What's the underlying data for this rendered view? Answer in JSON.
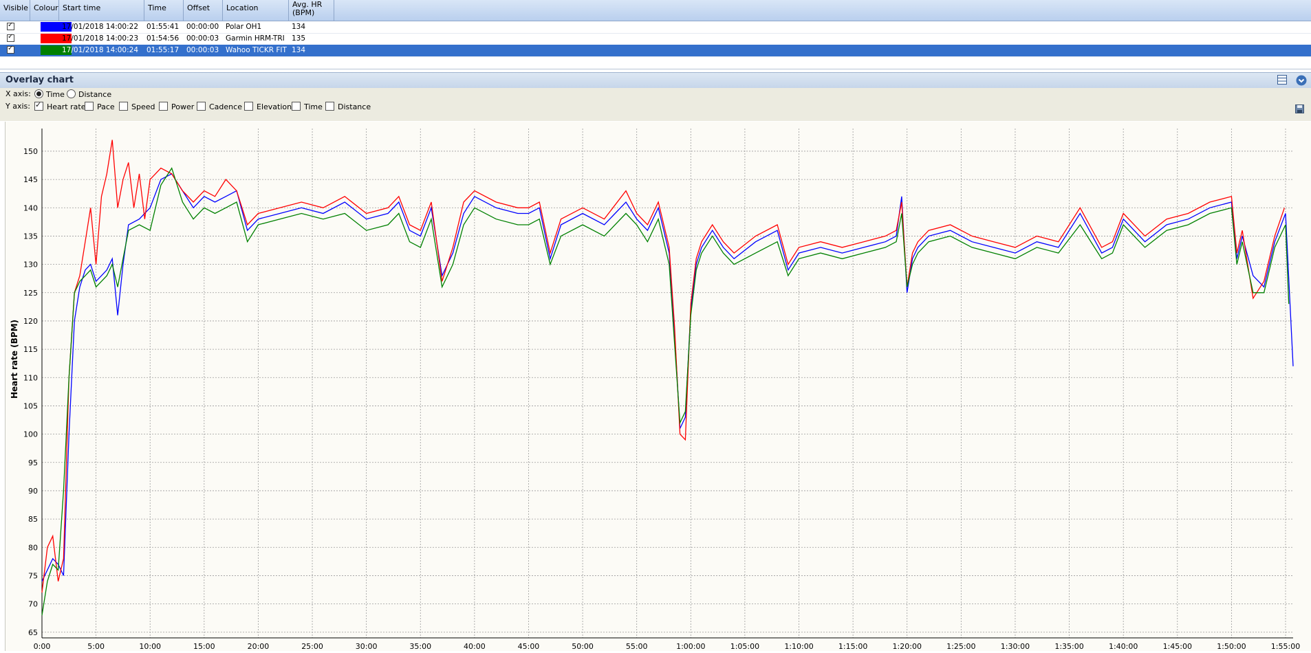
{
  "grid": {
    "headers": [
      "Visible",
      "Colour",
      "Start time",
      "Time",
      "Offset",
      "Location",
      "Avg. HR (BPM)"
    ],
    "rows": [
      {
        "start": "17/01/2018 14:00:22",
        "time": "01:55:41",
        "offset": "00:00:00",
        "location": "Polar OH1",
        "avg_hr": "134",
        "color": "#0000ff",
        "visible": true
      },
      {
        "start": "17/01/2018 14:00:23",
        "time": "01:54:56",
        "offset": "00:00:03",
        "location": "Garmin HRM-TRI",
        "avg_hr": "135",
        "color": "#ff0000",
        "visible": true
      },
      {
        "start": "17/01/2018 14:00:24",
        "time": "01:55:17",
        "offset": "00:00:03",
        "location": "Wahoo TICKR FIT",
        "avg_hr": "134",
        "color": "#008000",
        "visible": true,
        "selected": true
      }
    ]
  },
  "panel": {
    "title": "Overlay chart",
    "x_axis_label": "X axis:",
    "x_options": [
      {
        "label": "Time",
        "selected": true
      },
      {
        "label": "Distance",
        "selected": false
      }
    ],
    "y_axis_label": "Y axis:",
    "y_options": [
      {
        "label": "Heart rate",
        "checked": true
      },
      {
        "label": "Pace",
        "checked": false
      },
      {
        "label": "Speed",
        "checked": false
      },
      {
        "label": "Power",
        "checked": false
      },
      {
        "label": "Cadence",
        "checked": false
      },
      {
        "label": "Elevation",
        "checked": false
      },
      {
        "label": "Time",
        "checked": false
      },
      {
        "label": "Distance",
        "checked": false
      }
    ]
  },
  "chart_data": {
    "type": "line",
    "xlabel": "Time",
    "ylabel": "Heart rate (BPM)",
    "xlim": [
      0,
      115.7
    ],
    "ylim": [
      64,
      154
    ],
    "x_ticks": [
      {
        "v": 0,
        "label": "0:00"
      },
      {
        "v": 5,
        "label": "5:00"
      },
      {
        "v": 10,
        "label": "10:00"
      },
      {
        "v": 15,
        "label": "15:00"
      },
      {
        "v": 20,
        "label": "20:00"
      },
      {
        "v": 25,
        "label": "25:00"
      },
      {
        "v": 30,
        "label": "30:00"
      },
      {
        "v": 35,
        "label": "35:00"
      },
      {
        "v": 40,
        "label": "40:00"
      },
      {
        "v": 45,
        "label": "45:00"
      },
      {
        "v": 50,
        "label": "50:00"
      },
      {
        "v": 55,
        "label": "55:00"
      },
      {
        "v": 60,
        "label": "1:00:00"
      },
      {
        "v": 65,
        "label": "1:05:00"
      },
      {
        "v": 70,
        "label": "1:10:00"
      },
      {
        "v": 75,
        "label": "1:15:00"
      },
      {
        "v": 80,
        "label": "1:20:00"
      },
      {
        "v": 85,
        "label": "1:25:00"
      },
      {
        "v": 90,
        "label": "1:30:00"
      },
      {
        "v": 95,
        "label": "1:35:00"
      },
      {
        "v": 100,
        "label": "1:40:00"
      },
      {
        "v": 105,
        "label": "1:45:00"
      },
      {
        "v": 110,
        "label": "1:50:00"
      },
      {
        "v": 115,
        "label": "1:55:00"
      }
    ],
    "y_ticks": [
      65,
      70,
      75,
      80,
      85,
      90,
      95,
      100,
      105,
      110,
      115,
      120,
      125,
      130,
      135,
      140,
      145,
      150
    ],
    "grid": true,
    "series": [
      {
        "name": "Polar OH1",
        "color": "#0000ff",
        "x": [
          0,
          0.5,
          1,
          1.5,
          2,
          2.5,
          3,
          3.5,
          4,
          4.5,
          5,
          5.5,
          6,
          6.5,
          7,
          7.5,
          8,
          9,
          10,
          11,
          12,
          13,
          14,
          15,
          16,
          17,
          18,
          19,
          20,
          22,
          24,
          26,
          28,
          30,
          32,
          33,
          34,
          35,
          36,
          37,
          38,
          39,
          40,
          42,
          44,
          45,
          46,
          47,
          48,
          50,
          52,
          54,
          55,
          56,
          57,
          58,
          58.5,
          59,
          59.5,
          60,
          60.5,
          61,
          62,
          63,
          64,
          66,
          68,
          69,
          70,
          72,
          74,
          76,
          78,
          79,
          79.5,
          80,
          80.5,
          81,
          82,
          84,
          86,
          88,
          90,
          92,
          94,
          96,
          98,
          99,
          100,
          102,
          104,
          106,
          108,
          110,
          110.5,
          111,
          112,
          113,
          114,
          115,
          115.7
        ],
        "y": [
          74,
          76,
          78,
          77,
          75,
          100,
          120,
          126,
          129,
          130,
          127,
          128,
          129,
          131,
          121,
          130,
          137,
          138,
          140,
          145,
          146,
          143,
          140,
          142,
          141,
          142,
          143,
          136,
          138,
          139,
          140,
          139,
          141,
          138,
          139,
          141,
          136,
          135,
          140,
          128,
          132,
          139,
          142,
          140,
          139,
          139,
          140,
          131,
          137,
          139,
          137,
          141,
          138,
          136,
          140,
          132,
          118,
          101,
          103,
          122,
          130,
          133,
          136,
          133,
          131,
          134,
          136,
          129,
          132,
          133,
          132,
          133,
          134,
          135,
          142,
          125,
          131,
          133,
          135,
          136,
          134,
          133,
          132,
          134,
          133,
          139,
          132,
          133,
          138,
          134,
          137,
          138,
          140,
          141,
          131,
          135,
          128,
          126,
          134,
          139,
          112
        ]
      },
      {
        "name": "Garmin HRM-TRI",
        "color": "#ff0000",
        "x": [
          0,
          0.5,
          1,
          1.5,
          2,
          2.5,
          3,
          3.5,
          4,
          4.5,
          5,
          5.5,
          6,
          6.5,
          7,
          7.5,
          8,
          8.5,
          9,
          9.5,
          10,
          11,
          12,
          13,
          14,
          15,
          16,
          17,
          18,
          19,
          20,
          22,
          24,
          26,
          28,
          30,
          32,
          33,
          34,
          35,
          36,
          37,
          38,
          39,
          40,
          42,
          44,
          45,
          46,
          47,
          48,
          50,
          52,
          54,
          55,
          56,
          57,
          58,
          58.5,
          59,
          59.5,
          60,
          60.5,
          61,
          62,
          63,
          64,
          66,
          68,
          69,
          70,
          72,
          74,
          76,
          78,
          79,
          79.5,
          80,
          80.5,
          81,
          82,
          84,
          86,
          88,
          90,
          92,
          94,
          96,
          98,
          99,
          100,
          102,
          104,
          106,
          108,
          110,
          110.5,
          111,
          112,
          113,
          114,
          114.9
        ],
        "y": [
          72,
          80,
          82,
          74,
          78,
          110,
          125,
          128,
          134,
          140,
          130,
          142,
          146,
          152,
          140,
          145,
          148,
          140,
          146,
          138,
          145,
          147,
          146,
          143,
          141,
          143,
          142,
          145,
          143,
          137,
          139,
          140,
          141,
          140,
          142,
          139,
          140,
          142,
          137,
          136,
          141,
          127,
          133,
          141,
          143,
          141,
          140,
          140,
          141,
          132,
          138,
          140,
          138,
          143,
          139,
          137,
          141,
          133,
          119,
          100,
          99,
          123,
          131,
          134,
          137,
          134,
          132,
          135,
          137,
          130,
          133,
          134,
          133,
          134,
          135,
          136,
          141,
          126,
          132,
          134,
          136,
          137,
          135,
          134,
          133,
          135,
          134,
          140,
          133,
          134,
          139,
          135,
          138,
          139,
          141,
          142,
          132,
          136,
          124,
          127,
          135,
          140
        ]
      },
      {
        "name": "Wahoo TICKR FIT",
        "color": "#008000",
        "x": [
          0,
          0.5,
          1,
          1.5,
          2,
          2.5,
          3,
          3.5,
          4,
          4.5,
          5,
          5.5,
          6,
          6.5,
          7,
          7.5,
          8,
          9,
          10,
          11,
          12,
          13,
          14,
          15,
          16,
          17,
          18,
          19,
          20,
          22,
          24,
          26,
          28,
          30,
          32,
          33,
          34,
          35,
          36,
          37,
          38,
          39,
          40,
          42,
          44,
          45,
          46,
          47,
          48,
          50,
          52,
          54,
          55,
          56,
          57,
          58,
          58.5,
          59,
          59.5,
          60,
          60.5,
          61,
          62,
          63,
          64,
          66,
          68,
          69,
          70,
          72,
          74,
          76,
          78,
          79,
          79.5,
          80,
          80.5,
          81,
          82,
          84,
          86,
          88,
          90,
          92,
          94,
          96,
          98,
          99,
          100,
          102,
          104,
          106,
          108,
          110,
          110.5,
          111,
          112,
          113,
          114,
          115,
          115.3
        ],
        "y": [
          68,
          74,
          77,
          76,
          90,
          110,
          125,
          127,
          128,
          129,
          126,
          127,
          128,
          130,
          126,
          131,
          136,
          137,
          136,
          144,
          147,
          141,
          138,
          140,
          139,
          140,
          141,
          134,
          137,
          138,
          139,
          138,
          139,
          136,
          137,
          139,
          134,
          133,
          138,
          126,
          130,
          137,
          140,
          138,
          137,
          137,
          138,
          130,
          135,
          137,
          135,
          139,
          137,
          134,
          138,
          130,
          116,
          102,
          104,
          121,
          129,
          132,
          135,
          132,
          130,
          132,
          134,
          128,
          131,
          132,
          131,
          132,
          133,
          134,
          139,
          126,
          130,
          132,
          134,
          135,
          133,
          132,
          131,
          133,
          132,
          137,
          131,
          132,
          137,
          133,
          136,
          137,
          139,
          140,
          130,
          134,
          125,
          125,
          133,
          137,
          123
        ]
      }
    ]
  }
}
